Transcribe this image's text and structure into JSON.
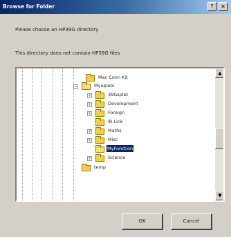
{
  "dialog": {
    "title": "Browse for Folder",
    "prompt": "Please choose an HP39G directory",
    "status": "This directory does not contain HP39G files"
  },
  "tree": {
    "items": [
      {
        "label": "Mac Conn Kit",
        "expander": ""
      },
      {
        "label": "Myaplets",
        "expander": "−"
      },
      {
        "label": "39Gsplet",
        "expander": "+"
      },
      {
        "label": "Development",
        "expander": "+"
      },
      {
        "label": "Foreign",
        "expander": "+"
      },
      {
        "label": "IR Link",
        "expander": ""
      },
      {
        "label": "Maths",
        "expander": "+"
      },
      {
        "label": "Misc",
        "expander": "+"
      },
      {
        "label": "MyFunction",
        "expander": "",
        "selected": true
      },
      {
        "label": "Science",
        "expander": "+"
      },
      {
        "label": "temp",
        "expander": ""
      }
    ]
  },
  "scrollbar": {
    "up_arrow": "▲",
    "down_arrow": "▼"
  },
  "titlebar": {
    "help_glyph": "?",
    "close_glyph": "✕"
  },
  "buttons": {
    "ok": "OK",
    "cancel": "Cancel"
  }
}
